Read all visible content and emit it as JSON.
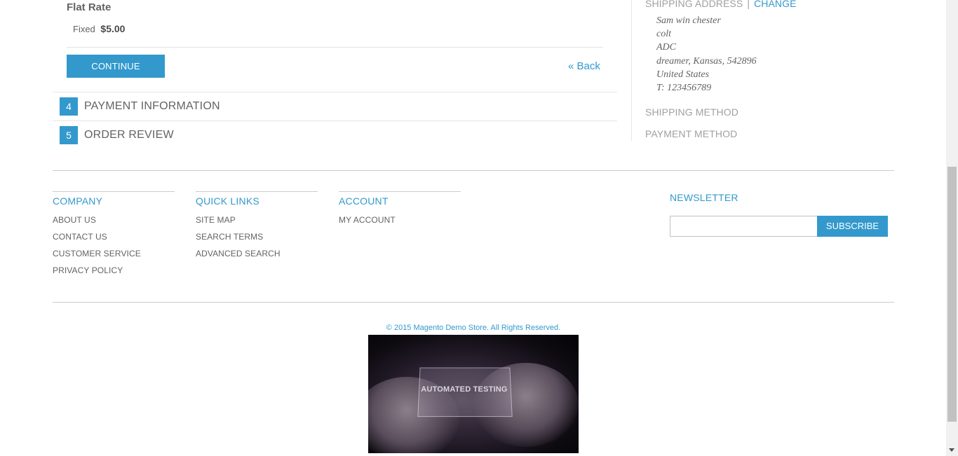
{
  "shipping_method_section": {
    "rate_title": "Flat Rate",
    "rate_type": "Fixed",
    "rate_price": "$5.00",
    "continue_label": "CONTINUE",
    "back_label": "« Back"
  },
  "checkout_steps": [
    {
      "number": "4",
      "label": "PAYMENT INFORMATION"
    },
    {
      "number": "5",
      "label": "ORDER REVIEW"
    }
  ],
  "progress_sidebar": {
    "shipping_address_heading": "SHIPPING ADDRESS",
    "separator": "|",
    "change_label": "CHANGE",
    "address_lines": [
      "Sam win chester",
      "colt",
      "ADC",
      "dreamer, Kansas, 542896",
      "United States",
      "T: 123456789"
    ],
    "shipping_method_heading": "SHIPPING METHOD",
    "payment_method_heading": "PAYMENT METHOD"
  },
  "footer": {
    "columns": [
      {
        "title": "COMPANY",
        "links": [
          "ABOUT US",
          "CONTACT US",
          "CUSTOMER SERVICE",
          "PRIVACY POLICY"
        ]
      },
      {
        "title": "QUICK LINKS",
        "links": [
          "SITE MAP",
          "SEARCH TERMS",
          "ADVANCED SEARCH"
        ]
      },
      {
        "title": "ACCOUNT",
        "links": [
          "MY ACCOUNT"
        ]
      }
    ],
    "newsletter": {
      "title": "NEWSLETTER",
      "input_value": "",
      "subscribe_label": "SUBSCRIBE"
    },
    "copyright": "© 2015 Magento Demo Store. All Rights Reserved.",
    "promo_image_text": "AUTOMATED TESTING"
  },
  "colors": {
    "accent": "#3399cc",
    "text": "#636363",
    "muted_heading": "#a0a0a0"
  }
}
